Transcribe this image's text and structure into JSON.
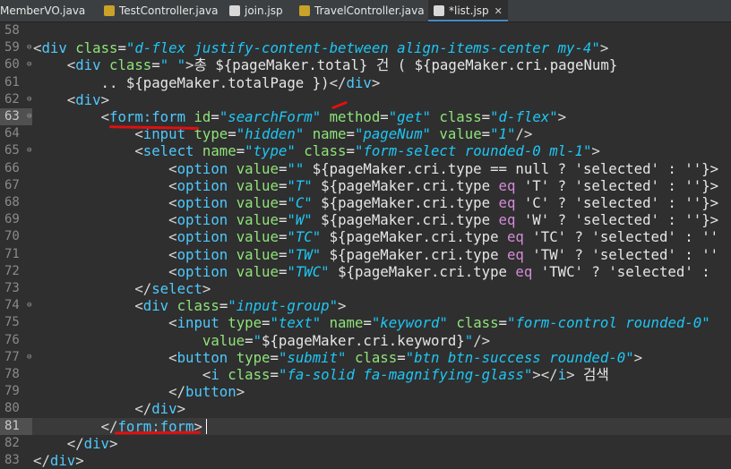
{
  "tabs": [
    {
      "label": "MemberVO.java",
      "icon": "java-file-icon"
    },
    {
      "label": "TestController.java",
      "icon": "java-file-icon"
    },
    {
      "label": "join.jsp",
      "icon": "jsp-file-icon"
    },
    {
      "label": "TravelController.java",
      "icon": "java-file-icon"
    },
    {
      "label": "*list.jsp",
      "icon": "jsp-file-icon",
      "active": true,
      "close": "✕"
    }
  ],
  "lines": [
    {
      "n": "58",
      "segs": []
    },
    {
      "n": "59",
      "fold": true,
      "segs": [
        [
          "br",
          "<"
        ],
        [
          "tn",
          "div "
        ],
        [
          "an",
          "class"
        ],
        [
          "el",
          "="
        ],
        [
          "av",
          "\"d-flex justify-content-between align-items-center my-4\""
        ],
        [
          "br",
          ">"
        ]
      ]
    },
    {
      "n": "60",
      "fold": true,
      "segs": [
        [
          "txt",
          "    "
        ],
        [
          "br",
          "<"
        ],
        [
          "tn",
          "div "
        ],
        [
          "an",
          "class"
        ],
        [
          "el",
          "="
        ],
        [
          "av",
          "\" \""
        ],
        [
          "br",
          ">"
        ],
        [
          "txt",
          "총 ${pageMaker.total} 건 ( ${pageMaker.cri.pageNum}"
        ]
      ]
    },
    {
      "n": "61",
      "segs": [
        [
          "txt",
          "        .. ${pageMaker.totalPage })"
        ],
        [
          "br",
          "</"
        ],
        [
          "tn",
          "div"
        ],
        [
          "br",
          ">"
        ]
      ]
    },
    {
      "n": "62",
      "fold": true,
      "segs": [
        [
          "txt",
          "    "
        ],
        [
          "br",
          "<"
        ],
        [
          "tn",
          "div"
        ],
        [
          "br",
          ">"
        ]
      ]
    },
    {
      "n": "63",
      "fold": true,
      "hl": true,
      "segs": [
        [
          "txt",
          "        "
        ],
        [
          "br",
          "<"
        ],
        [
          "tn",
          "form:form "
        ],
        [
          "an",
          "id"
        ],
        [
          "el",
          "="
        ],
        [
          "av",
          "\"searchForm\""
        ],
        [
          "txt",
          " "
        ],
        [
          "an",
          "method"
        ],
        [
          "el",
          "="
        ],
        [
          "av",
          "\"get\""
        ],
        [
          "txt",
          " "
        ],
        [
          "an",
          "class"
        ],
        [
          "el",
          "="
        ],
        [
          "av",
          "\"d-flex\""
        ],
        [
          "br",
          ">"
        ]
      ]
    },
    {
      "n": "64",
      "segs": [
        [
          "txt",
          "            "
        ],
        [
          "br",
          "<"
        ],
        [
          "tn",
          "input "
        ],
        [
          "an",
          "type"
        ],
        [
          "el",
          "="
        ],
        [
          "av",
          "\"hidden\""
        ],
        [
          "txt",
          " "
        ],
        [
          "an",
          "name"
        ],
        [
          "el",
          "="
        ],
        [
          "av",
          "\"pageNum\""
        ],
        [
          "txt",
          " "
        ],
        [
          "an",
          "value"
        ],
        [
          "el",
          "="
        ],
        [
          "av",
          "\"1\""
        ],
        [
          "br",
          "/>"
        ]
      ]
    },
    {
      "n": "65",
      "fold": true,
      "segs": [
        [
          "txt",
          "            "
        ],
        [
          "br",
          "<"
        ],
        [
          "tn",
          "select "
        ],
        [
          "an",
          "name"
        ],
        [
          "el",
          "="
        ],
        [
          "av",
          "\"type\""
        ],
        [
          "txt",
          " "
        ],
        [
          "an",
          "class"
        ],
        [
          "el",
          "="
        ],
        [
          "av",
          "\"form-select rounded-0 ml-1\""
        ],
        [
          "br",
          ">"
        ]
      ]
    },
    {
      "n": "66",
      "segs": [
        [
          "txt",
          "                "
        ],
        [
          "br",
          "<"
        ],
        [
          "tn",
          "option "
        ],
        [
          "an",
          "value"
        ],
        [
          "el",
          "="
        ],
        [
          "av",
          "\"\""
        ],
        [
          "txt",
          " ${pageMaker.cri.type == null ? 'selected' : ''}>"
        ]
      ]
    },
    {
      "n": "67",
      "segs": [
        [
          "txt",
          "                "
        ],
        [
          "br",
          "<"
        ],
        [
          "tn",
          "option "
        ],
        [
          "an",
          "value"
        ],
        [
          "el",
          "="
        ],
        [
          "av",
          "\"T\""
        ],
        [
          "txt",
          " ${pageMaker.cri.type "
        ],
        [
          "kw",
          "eq"
        ],
        [
          "txt",
          " 'T' ? 'selected' : ''}>"
        ]
      ]
    },
    {
      "n": "68",
      "segs": [
        [
          "txt",
          "                "
        ],
        [
          "br",
          "<"
        ],
        [
          "tn",
          "option "
        ],
        [
          "an",
          "value"
        ],
        [
          "el",
          "="
        ],
        [
          "av",
          "\"C\""
        ],
        [
          "txt",
          " ${pageMaker.cri.type "
        ],
        [
          "kw",
          "eq"
        ],
        [
          "txt",
          " 'C' ? 'selected' : ''}>"
        ]
      ]
    },
    {
      "n": "69",
      "segs": [
        [
          "txt",
          "                "
        ],
        [
          "br",
          "<"
        ],
        [
          "tn",
          "option "
        ],
        [
          "an",
          "value"
        ],
        [
          "el",
          "="
        ],
        [
          "av",
          "\"W\""
        ],
        [
          "txt",
          " ${pageMaker.cri.type "
        ],
        [
          "kw",
          "eq"
        ],
        [
          "txt",
          " 'W' ? 'selected' : ''}>"
        ]
      ]
    },
    {
      "n": "70",
      "segs": [
        [
          "txt",
          "                "
        ],
        [
          "br",
          "<"
        ],
        [
          "tn",
          "option "
        ],
        [
          "an",
          "value"
        ],
        [
          "el",
          "="
        ],
        [
          "av",
          "\"TC\""
        ],
        [
          "txt",
          " ${pageMaker.cri.type "
        ],
        [
          "kw",
          "eq"
        ],
        [
          "txt",
          " 'TC' ? 'selected' : ''"
        ]
      ]
    },
    {
      "n": "71",
      "segs": [
        [
          "txt",
          "                "
        ],
        [
          "br",
          "<"
        ],
        [
          "tn",
          "option "
        ],
        [
          "an",
          "value"
        ],
        [
          "el",
          "="
        ],
        [
          "av",
          "\"TW\""
        ],
        [
          "txt",
          " ${pageMaker.cri.type "
        ],
        [
          "kw",
          "eq"
        ],
        [
          "txt",
          " 'TW' ? 'selected' : ''"
        ]
      ]
    },
    {
      "n": "72",
      "segs": [
        [
          "txt",
          "                "
        ],
        [
          "br",
          "<"
        ],
        [
          "tn",
          "option "
        ],
        [
          "an",
          "value"
        ],
        [
          "el",
          "="
        ],
        [
          "av",
          "\"TWC\""
        ],
        [
          "txt",
          " ${pageMaker.cri.type "
        ],
        [
          "kw",
          "eq"
        ],
        [
          "txt",
          " 'TWC' ? 'selected' : "
        ]
      ]
    },
    {
      "n": "73",
      "segs": [
        [
          "txt",
          "            "
        ],
        [
          "br",
          "</"
        ],
        [
          "tn",
          "select"
        ],
        [
          "br",
          ">"
        ]
      ]
    },
    {
      "n": "74",
      "fold": true,
      "segs": [
        [
          "txt",
          "            "
        ],
        [
          "br",
          "<"
        ],
        [
          "tn",
          "div "
        ],
        [
          "an",
          "class"
        ],
        [
          "el",
          "="
        ],
        [
          "av",
          "\"input-group\""
        ],
        [
          "br",
          ">"
        ]
      ]
    },
    {
      "n": "75",
      "segs": [
        [
          "txt",
          "                "
        ],
        [
          "br",
          "<"
        ],
        [
          "tn",
          "input "
        ],
        [
          "an",
          "type"
        ],
        [
          "el",
          "="
        ],
        [
          "av",
          "\"text\""
        ],
        [
          "txt",
          " "
        ],
        [
          "an",
          "name"
        ],
        [
          "el",
          "="
        ],
        [
          "av",
          "\"keyword\""
        ],
        [
          "txt",
          " "
        ],
        [
          "an",
          "class"
        ],
        [
          "el",
          "="
        ],
        [
          "av",
          "\"form-control rounded-0\""
        ]
      ]
    },
    {
      "n": "76",
      "segs": [
        [
          "txt",
          "                    "
        ],
        [
          "an",
          "value"
        ],
        [
          "el",
          "="
        ],
        [
          "av",
          "\""
        ],
        [
          "txt",
          "${pageMaker.cri.keyword}"
        ],
        [
          "av",
          "\""
        ],
        [
          "br",
          "/>"
        ]
      ]
    },
    {
      "n": "77",
      "fold": true,
      "segs": [
        [
          "txt",
          "                "
        ],
        [
          "br",
          "<"
        ],
        [
          "tn",
          "button "
        ],
        [
          "an",
          "type"
        ],
        [
          "el",
          "="
        ],
        [
          "av",
          "\"submit\""
        ],
        [
          "txt",
          " "
        ],
        [
          "an",
          "class"
        ],
        [
          "el",
          "="
        ],
        [
          "av",
          "\"btn btn-success rounded-0\""
        ],
        [
          "br",
          ">"
        ]
      ]
    },
    {
      "n": "78",
      "segs": [
        [
          "txt",
          "                    "
        ],
        [
          "br",
          "<"
        ],
        [
          "tn",
          "i "
        ],
        [
          "an",
          "class"
        ],
        [
          "el",
          "="
        ],
        [
          "av",
          "\"fa-solid fa-magnifying-glass\""
        ],
        [
          "br",
          "></"
        ],
        [
          "tn",
          "i"
        ],
        [
          "br",
          ">"
        ],
        [
          "txt",
          " 검색"
        ]
      ]
    },
    {
      "n": "79",
      "segs": [
        [
          "txt",
          "                "
        ],
        [
          "br",
          "</"
        ],
        [
          "tn",
          "button"
        ],
        [
          "br",
          ">"
        ]
      ]
    },
    {
      "n": "80",
      "segs": [
        [
          "txt",
          "            "
        ],
        [
          "br",
          "</"
        ],
        [
          "tn",
          "div"
        ],
        [
          "br",
          ">"
        ]
      ]
    },
    {
      "n": "81",
      "cur": true,
      "hl": true,
      "segs": [
        [
          "txt",
          "        "
        ],
        [
          "br",
          "</"
        ],
        [
          "tn",
          "form:form"
        ],
        [
          "br",
          ">"
        ]
      ]
    },
    {
      "n": "82",
      "segs": [
        [
          "txt",
          "    "
        ],
        [
          "br",
          "</"
        ],
        [
          "tn",
          "div"
        ],
        [
          "br",
          ">"
        ]
      ]
    },
    {
      "n": "83",
      "segs": [
        [
          "br",
          "</"
        ],
        [
          "tn",
          "div"
        ],
        [
          "br",
          ">"
        ]
      ]
    }
  ],
  "fold_marker": "⊖"
}
